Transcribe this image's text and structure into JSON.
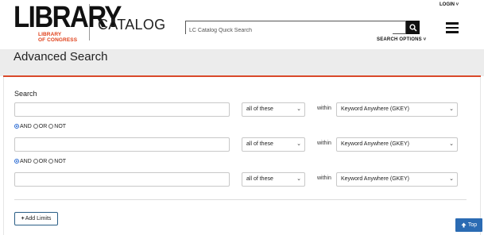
{
  "header": {
    "logo_main": "LIBRARY",
    "logo_sub_line1": "LIBRARY",
    "logo_sub_line2": "OF CONGRESS",
    "catalog_label": "CATALOG",
    "search_placeholder": "LC Catalog Quick Search",
    "search_options_label": "SEARCH OPTIONS ˅",
    "login_label": "LOGIN ˅",
    "brand_color": "#e0401a"
  },
  "page": {
    "title": "Advanced Search",
    "accent_color": "#d9492a"
  },
  "form": {
    "search_label": "Search",
    "within_label": "within",
    "rows": [
      {
        "term_value": "",
        "match_value": "all of these",
        "index_value": "Keyword Anywhere (GKEY)"
      },
      {
        "term_value": "",
        "match_value": "all of these",
        "index_value": "Keyword Anywhere (GKEY)"
      },
      {
        "term_value": "",
        "match_value": "all of these",
        "index_value": "Keyword Anywhere (GKEY)"
      }
    ],
    "operators": [
      {
        "and_label": "AND",
        "or_label": "OR",
        "not_label": "NOT",
        "selected": "AND"
      },
      {
        "and_label": "AND",
        "or_label": "OR",
        "not_label": "NOT",
        "selected": "AND"
      }
    ],
    "add_limits_label": "Add Limits"
  },
  "footer": {
    "top_label": "Top",
    "top_color": "#2b6bb3"
  }
}
